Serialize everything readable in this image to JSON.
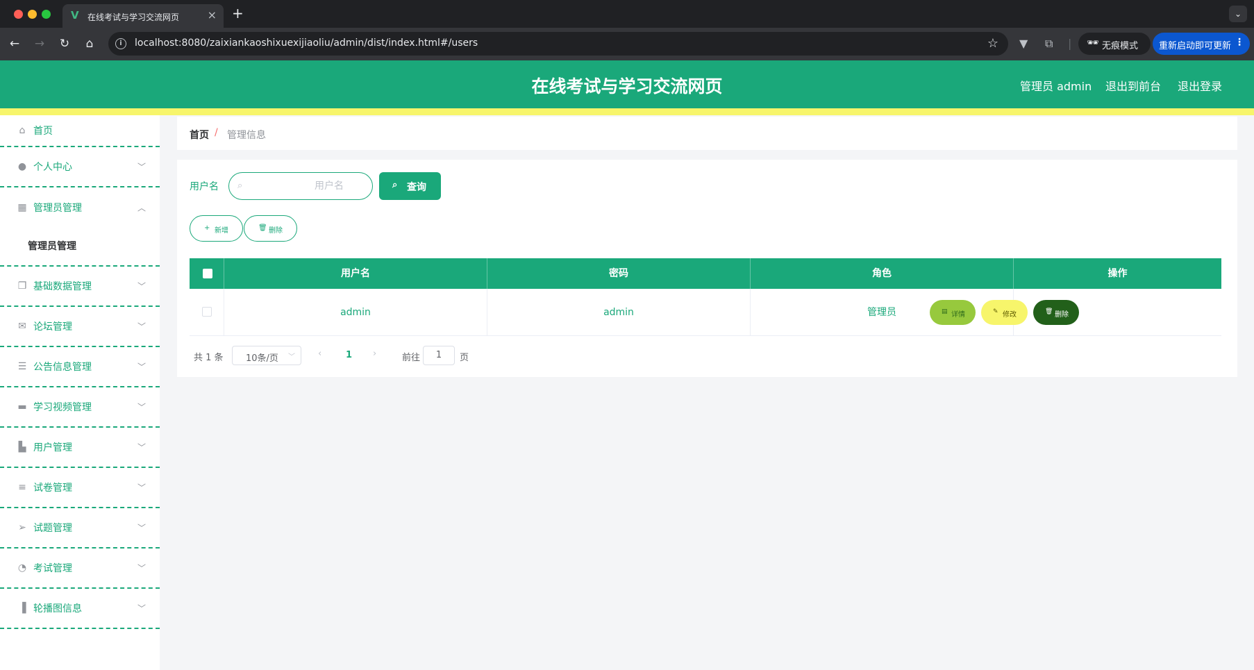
{
  "browser": {
    "tab_title": "在线考试与学习交流网页",
    "tab_icon": "vue-logo-icon",
    "url": "localhost:8080/zaixiankaoshixuexijiaoliu/admin/dist/index.html#/users",
    "incognito_label": "无痕模式",
    "update_label": "重新启动即可更新"
  },
  "header": {
    "title": "在线考试与学习交流网页",
    "user_label": "管理员 admin",
    "back_front_label": "退出到前台",
    "logout_label": "退出登录",
    "accent_color": "#1aa87a",
    "stripe_color": "#f7f56b"
  },
  "sidebar": {
    "items": [
      {
        "label": "首页",
        "icon": "home-icon"
      },
      {
        "label": "个人中心",
        "icon": "user-icon"
      },
      {
        "label": "管理员管理",
        "icon": "grid-icon"
      },
      {
        "label": "基础数据管理",
        "icon": "copy-icon"
      },
      {
        "label": "论坛管理",
        "icon": "mail-icon"
      },
      {
        "label": "公告信息管理",
        "icon": "list-icon"
      },
      {
        "label": "学习视频管理",
        "icon": "monitor-icon"
      },
      {
        "label": "用户管理",
        "icon": "suitcase-icon"
      },
      {
        "label": "试卷管理",
        "icon": "sort-icon"
      },
      {
        "label": "试题管理",
        "icon": "send-icon"
      },
      {
        "label": "考试管理",
        "icon": "dashboard-icon"
      },
      {
        "label": "轮播图信息",
        "icon": "bar-chart-icon"
      }
    ],
    "submenu": {
      "label": "管理员管理"
    }
  },
  "breadcrumb": {
    "home": "首页",
    "separator": "/",
    "current": "管理信息"
  },
  "search": {
    "label": "用户名",
    "placeholder": "用户名",
    "value": "",
    "button_label": "查询"
  },
  "actions": {
    "add_label": "新增",
    "delete_label": "删除"
  },
  "table": {
    "columns": [
      "用户名",
      "密码",
      "角色",
      "操作"
    ],
    "rows": [
      {
        "username": "admin",
        "password": "admin",
        "role": "管理员"
      }
    ],
    "row_actions": {
      "detail": "详情",
      "edit": "修改",
      "delete": "删除"
    }
  },
  "pagination": {
    "total": "共 1 条",
    "page_size": "10条/页",
    "current_page": "1",
    "goto_label": "前往",
    "goto_value": "1",
    "page_suffix": "页"
  }
}
